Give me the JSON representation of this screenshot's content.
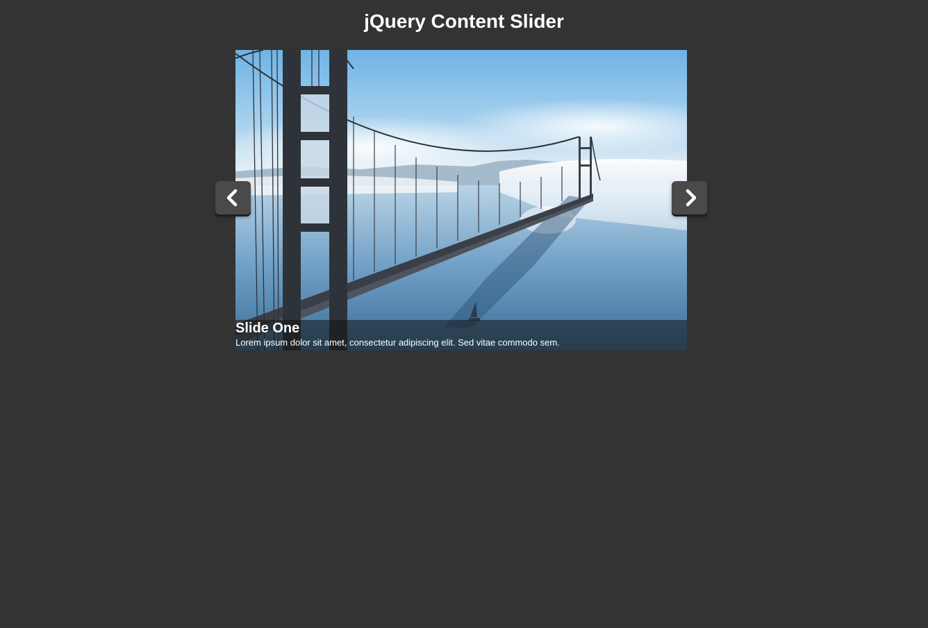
{
  "page": {
    "title": "jQuery Content Slider"
  },
  "slider": {
    "current_slide": {
      "title": "Slide One",
      "text": "Lorem ipsum dolor sit amet, consectetur adipiscing elit. Sed vitae commodo sem."
    },
    "prev_icon": "chevron-left-icon",
    "next_icon": "chevron-right-icon"
  },
  "colors": {
    "background": "#333333",
    "button": "#4a4a4a",
    "text": "#ffffff"
  }
}
